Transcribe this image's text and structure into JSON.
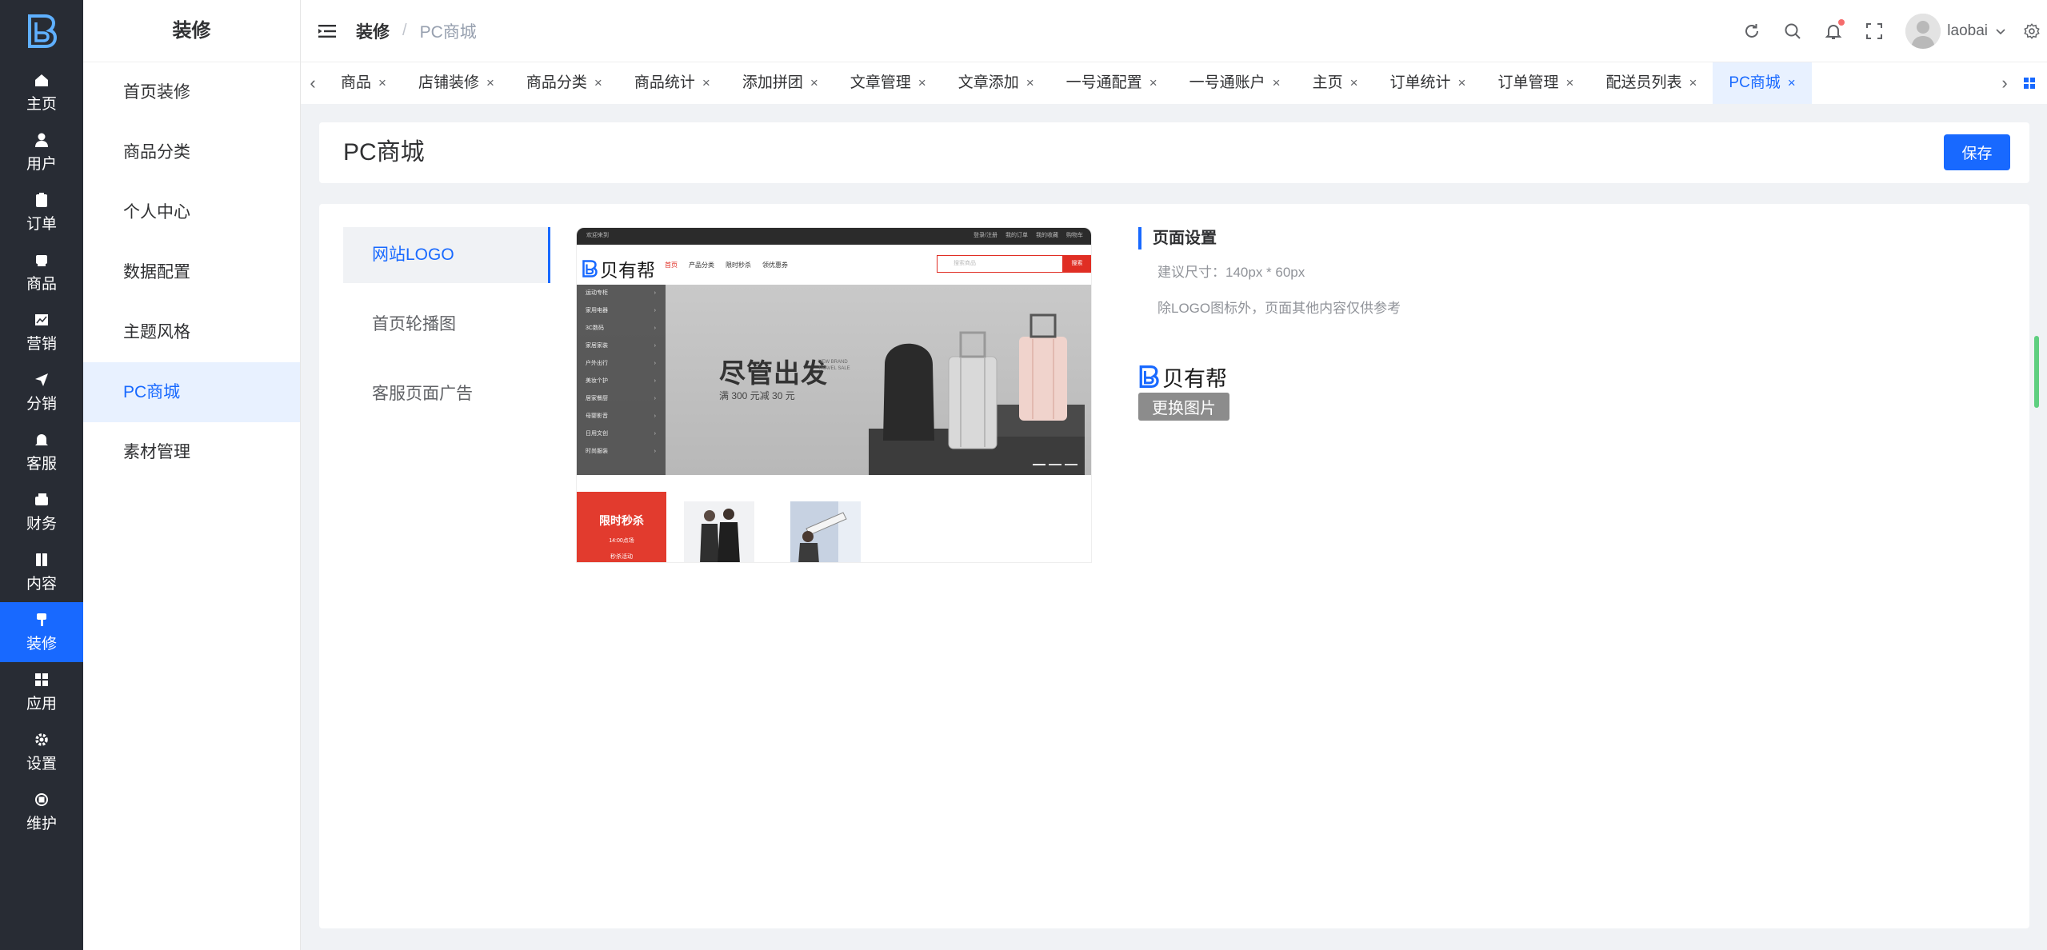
{
  "rail": {
    "items": [
      {
        "label": "主页",
        "icon": "home-icon"
      },
      {
        "label": "用户",
        "icon": "user-icon"
      },
      {
        "label": "订单",
        "icon": "clipboard-icon"
      },
      {
        "label": "商品",
        "icon": "goods-icon"
      },
      {
        "label": "营销",
        "icon": "chart-icon"
      },
      {
        "label": "分销",
        "icon": "send-icon"
      },
      {
        "label": "客服",
        "icon": "bell-icon"
      },
      {
        "label": "财务",
        "icon": "wallet-icon"
      },
      {
        "label": "内容",
        "icon": "book-icon"
      },
      {
        "label": "装修",
        "icon": "brush-icon"
      },
      {
        "label": "应用",
        "icon": "apps-icon"
      },
      {
        "label": "设置",
        "icon": "gear-icon"
      },
      {
        "label": "维护",
        "icon": "chip-icon"
      }
    ],
    "active_index": 9
  },
  "submenu": {
    "title": "装修",
    "items": [
      "首页装修",
      "商品分类",
      "个人中心",
      "数据配置",
      "主题风格",
      "PC商城",
      "素材管理"
    ],
    "active_index": 5
  },
  "header": {
    "breadcrumb_parent": "装修",
    "breadcrumb_separator": "/",
    "breadcrumb_current": "PC商城",
    "username": "laobai"
  },
  "tabs": {
    "items": [
      "商品",
      "店铺装修",
      "商品分类",
      "商品统计",
      "添加拼团",
      "文章管理",
      "文章添加",
      "一号通配置",
      "一号通账户",
      "主页",
      "订单统计",
      "订单管理",
      "配送员列表",
      "PC商城"
    ],
    "active_index": 13,
    "close_glyph": "×"
  },
  "page": {
    "title": "PC商城",
    "save_label": "保存"
  },
  "settings_nav": {
    "items": [
      "网站LOGO",
      "首页轮播图",
      "客服页面广告"
    ],
    "active_index": 0
  },
  "preview": {
    "topbar_left": "欢迎来到",
    "topbar_right": [
      "登录/注册",
      "我的订单",
      "我的收藏",
      "购物车"
    ],
    "brand": "贝有帮",
    "nav": [
      "首页",
      "产品分类",
      "限时秒杀",
      "领优惠券"
    ],
    "search_placeholder": "搜索商品",
    "search_button": "搜索",
    "categories": [
      "运动专柜",
      "家用电器",
      "3C数码",
      "家居家装",
      "户外出行",
      "美妆个护",
      "居家餐厨",
      "母婴影音",
      "日用文创",
      "时尚服装"
    ],
    "slogan": "尽管出发",
    "slogan_sub": "满 300 元减 30 元",
    "slogan_en": [
      "NEW BRAND",
      "TRAVEL SALE"
    ],
    "seckill_title": "限时秒杀",
    "seckill_time": "14:00点场",
    "seckill_note": "秒杀活动"
  },
  "page_settings": {
    "heading": "页面设置",
    "size_tip": "建议尺寸：140px * 60px",
    "note": "除LOGO图标外，页面其他内容仅供参考",
    "logo_text": "贝有帮",
    "change_label": "更换图片"
  },
  "colors": {
    "primary": "#1869ff",
    "rail_bg": "#282c34",
    "accent_red": "#e02e24",
    "scroll_thumb": "#5fcf80"
  }
}
